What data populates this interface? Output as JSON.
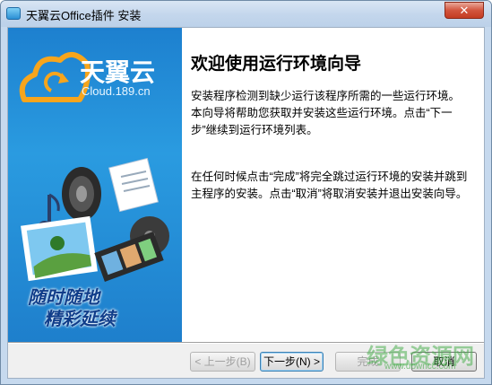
{
  "window": {
    "title": "天翼云Office插件 安装",
    "close_glyph": "✕"
  },
  "banner": {
    "logo_text": "天翼云",
    "logo_sub": "Cloud.189.cn",
    "slogan_line1": "随时随地",
    "slogan_line2": "精彩延续"
  },
  "main": {
    "heading": "欢迎使用运行环境向导",
    "paragraph1": "安装程序检测到缺少运行该程序所需的一些运行环境。本向导将帮助您获取并安装这些运行环境。点击“下一步”继续到运行环境列表。",
    "paragraph2": "在任何时候点击“完成”将完全跳过运行环境的安装并跳到主程序的安装。点击“取消”将取消安装并退出安装向导。"
  },
  "buttons": {
    "back": "< 上一步(B)",
    "next": "下一步(N) >",
    "finish": "完成",
    "cancel": "取消"
  },
  "watermark": {
    "text": "绿色资源网",
    "url": "www.downcc.com"
  },
  "colors": {
    "banner_blue": "#1e88d4",
    "title_bar": "#c3d6ec",
    "close_red": "#c43b22"
  }
}
